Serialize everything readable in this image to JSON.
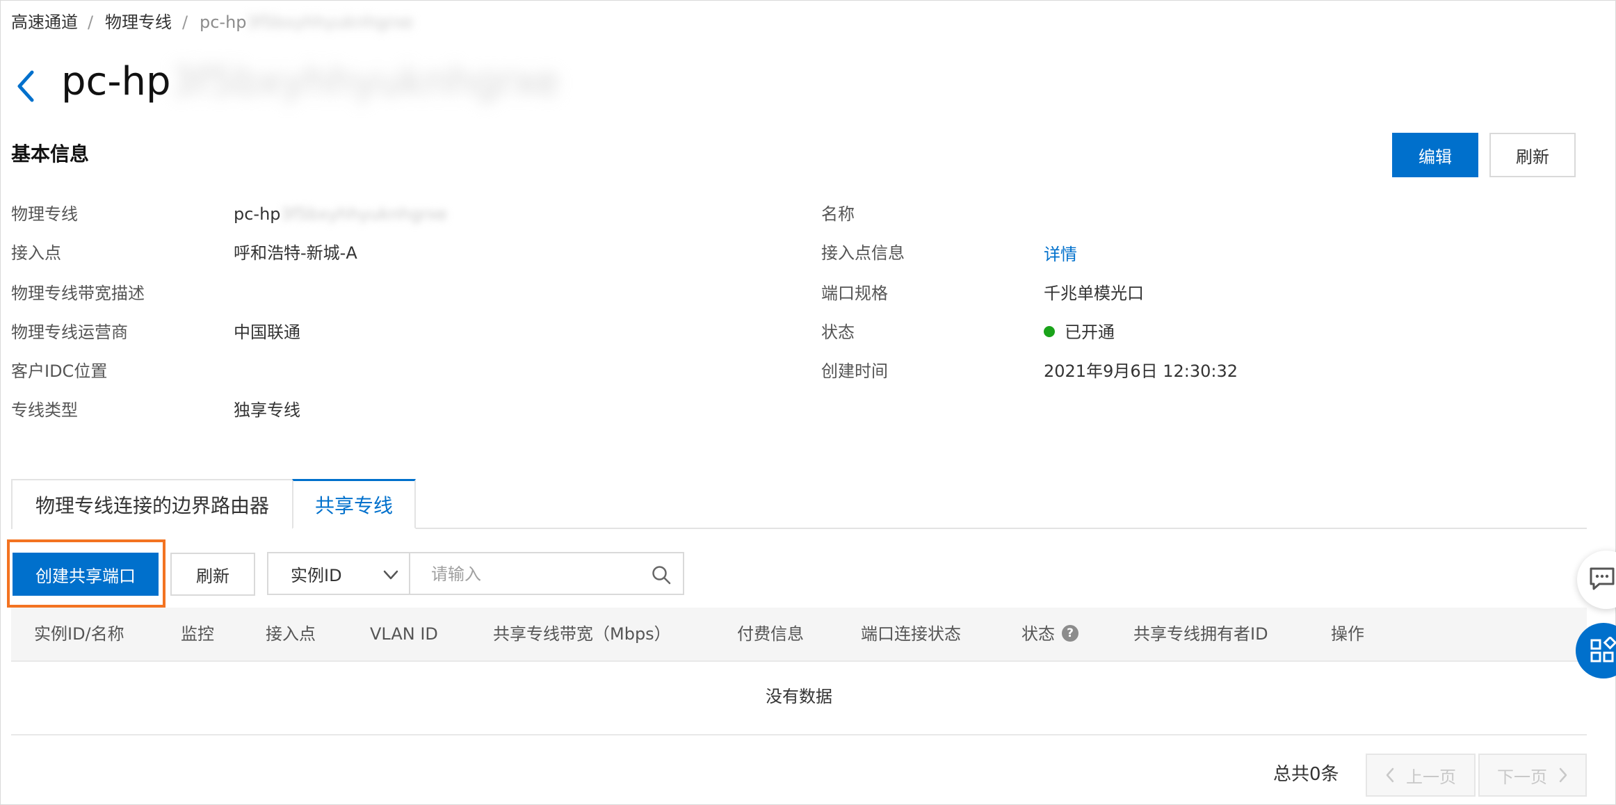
{
  "breadcrumb": {
    "item1": "高速通道",
    "item2": "物理专线",
    "current_prefix": "pc-hp",
    "current_obscured": "3f5bxyhhyuknhgrxe",
    "separator": "/"
  },
  "title": {
    "prefix": "pc-hp",
    "obscured": "3f5bxyhhyuknhgrxe"
  },
  "basic_info": {
    "heading": "基本信息",
    "edit_label": "编辑",
    "refresh_label": "刷新",
    "left_fields": [
      {
        "label": "物理专线",
        "value_prefix": "pc-hp",
        "value_obscured": "3f5bxyhhyuknhgrxe"
      },
      {
        "label": "接入点",
        "value": "呼和浩特-新城-A"
      },
      {
        "label": "物理专线带宽描述",
        "value": ""
      },
      {
        "label": "物理专线运营商",
        "value": "中国联通"
      },
      {
        "label": "客户IDC位置",
        "value": ""
      },
      {
        "label": "专线类型",
        "value": "独享专线"
      }
    ],
    "right_fields": [
      {
        "label": "名称",
        "value": ""
      },
      {
        "label": "接入点信息",
        "value": "详情"
      },
      {
        "label": "端口规格",
        "value": "千兆单模光口"
      },
      {
        "label": "状态",
        "value": "已开通",
        "status_color": "#1aa31a"
      },
      {
        "label": "创建时间",
        "value": "2021年9月6日 12:30:32"
      }
    ]
  },
  "tabs": [
    {
      "label": "物理专线连接的边界路由器",
      "active": false
    },
    {
      "label": "共享专线",
      "active": true
    }
  ],
  "toolbar": {
    "create_label": "创建共享端口",
    "refresh_label": "刷新",
    "filter_selected": "实例ID",
    "search_placeholder": "请输入"
  },
  "table": {
    "columns": [
      "实例ID/名称",
      "监控",
      "接入点",
      "VLAN ID",
      "共享专线带宽（Mbps）",
      "付费信息",
      "端口连接状态",
      "状态",
      "共享专线拥有者ID",
      "操作"
    ],
    "help_mark": "?",
    "empty_text": "没有数据"
  },
  "pagination": {
    "total": "总共0条",
    "prev": "上一页",
    "next": "下一页"
  },
  "colors": {
    "primary": "#0070cc",
    "highlight": "#f37321",
    "status_ok": "#1aa31a"
  },
  "icons": [
    "chevron-left-icon",
    "chevron-down-icon",
    "search-icon",
    "chat-icon",
    "apps-icon",
    "help-icon"
  ]
}
